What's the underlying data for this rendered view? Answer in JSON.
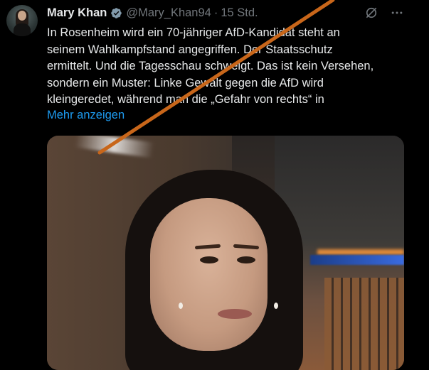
{
  "tweet": {
    "author_name": "Mary Khan",
    "handle": "@Mary_Khan94",
    "separator": "·",
    "time": "15 Std.",
    "text_lines": [
      "In Rosenheim wird ein 70-jähriger AfD-Kandidat steht an",
      "seinem Wahlkampfstand angegriffen. Der Staatsschutz",
      "ermittelt. Und die Tagesschau schweigt. Das ist kein Versehen,",
      "sondern ein Muster: Linke Gewalt gegen die AfD wird",
      "kleingeredet, während man die „Gefahr von rechts“ in"
    ],
    "show_more": "Mehr anzeigen"
  },
  "icons": {
    "verified": "verified-badge-icon",
    "grok": "grok-icon",
    "more": "more-options-icon"
  },
  "colors": {
    "background": "#000000",
    "text": "#e7e9ea",
    "muted": "#71767b",
    "link": "#1d9bf0",
    "slash": "#c8661a"
  }
}
